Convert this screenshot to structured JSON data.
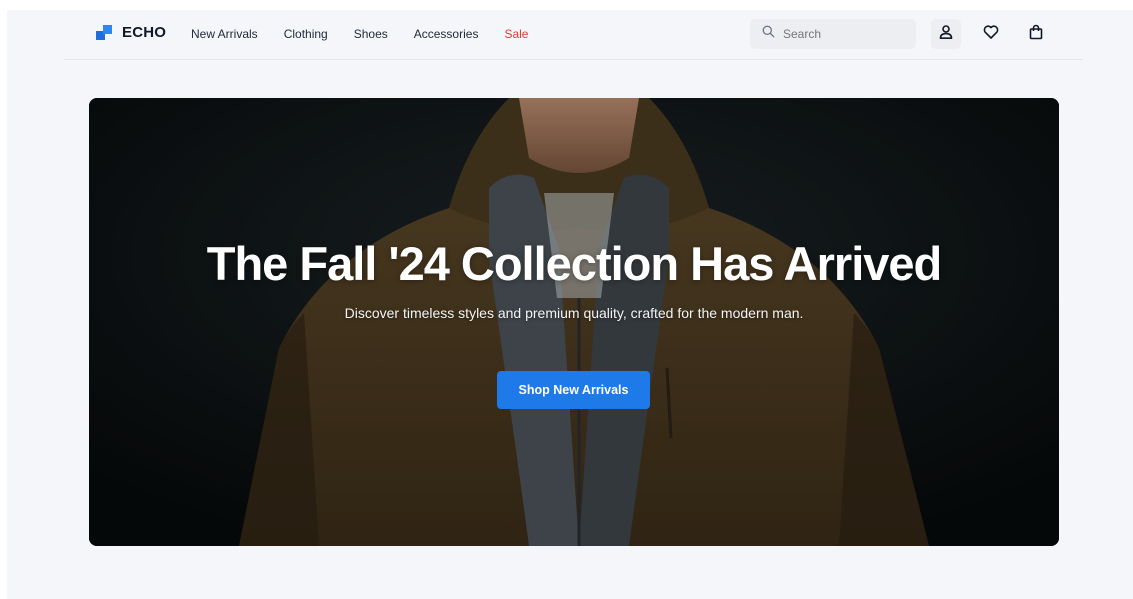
{
  "brand": {
    "name": "ECHO",
    "logo_icon": "echo-logo-icon",
    "colors": {
      "primary": "#1d6fe0",
      "secondary": "#2f86f0"
    }
  },
  "nav": {
    "items": [
      {
        "label": "New Arrivals"
      },
      {
        "label": "Clothing"
      },
      {
        "label": "Shoes"
      },
      {
        "label": "Accessories"
      },
      {
        "label": "Sale",
        "color": "#e53935"
      }
    ]
  },
  "search": {
    "placeholder": "Search",
    "icon": "search-icon"
  },
  "header_actions": {
    "icons": [
      "user-icon",
      "heart-icon",
      "shopping-bag-icon"
    ]
  },
  "hero": {
    "title": "The Fall '24 Collection Has Arrived",
    "subtitle": "Discover timeless styles and premium quality, crafted for the modern man.",
    "cta_label": "Shop New Arrivals",
    "cta_color": "#1d7ae8",
    "image_icon": "man-in-olive-jacket-photo"
  }
}
